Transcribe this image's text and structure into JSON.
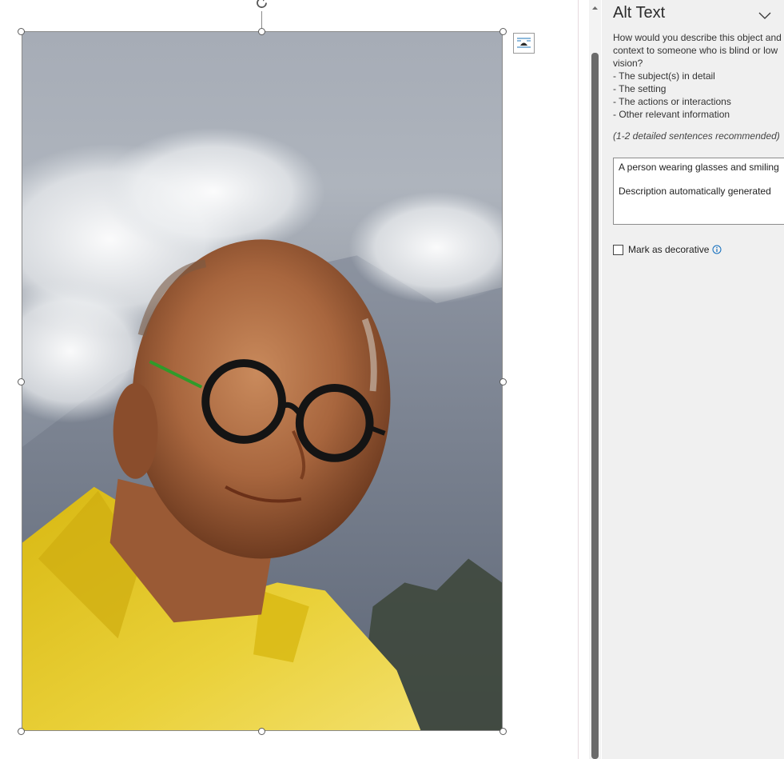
{
  "pane": {
    "title": "Alt Text",
    "instructions": {
      "intro": "How would you describe this object and context to someone who is blind or low vision?",
      "bullets": [
        "- The subject(s) in detail",
        "- The setting",
        "- The actions or interactions",
        "- Other relevant information"
      ]
    },
    "hint": "(1-2 detailed sentences recommended)",
    "alt_text": {
      "line1": "A person wearing glasses and smiling",
      "line2": "Description automatically generated"
    },
    "decorative_label": "Mark as decorative",
    "decorative_checked": false
  },
  "icons": {
    "rotate": "rotate-icon",
    "layout": "layout-options-icon",
    "collapse": "chevron-down-icon",
    "info": "info-icon"
  },
  "colors": {
    "accent": "#0f6cbd",
    "pane_bg": "#f0f0f0",
    "scroll_thumb": "#6b6b6b",
    "shirt": "#e3c21a"
  }
}
